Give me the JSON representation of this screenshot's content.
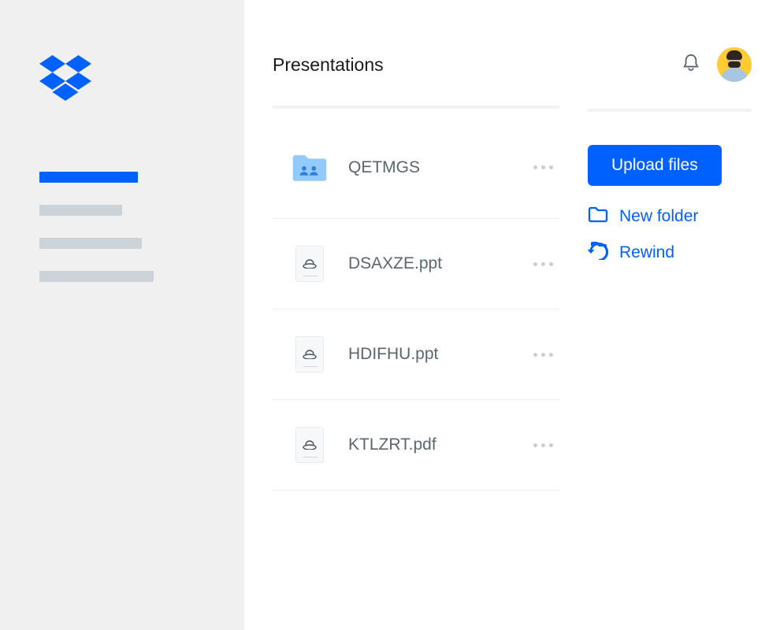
{
  "header": {
    "title": "Presentations"
  },
  "files": [
    {
      "name": "QETMGS",
      "type": "folder"
    },
    {
      "name": "DSAXZE.ppt",
      "type": "file"
    },
    {
      "name": "HDIFHU.ppt",
      "type": "file"
    },
    {
      "name": "KTLZRT.pdf",
      "type": "file"
    }
  ],
  "actions": {
    "upload_label": "Upload files",
    "new_folder_label": "New folder",
    "rewind_label": "Rewind"
  },
  "colors": {
    "primary": "#0061ff",
    "text_muted": "#5a6670",
    "avatar_bg": "#ffcc33"
  }
}
